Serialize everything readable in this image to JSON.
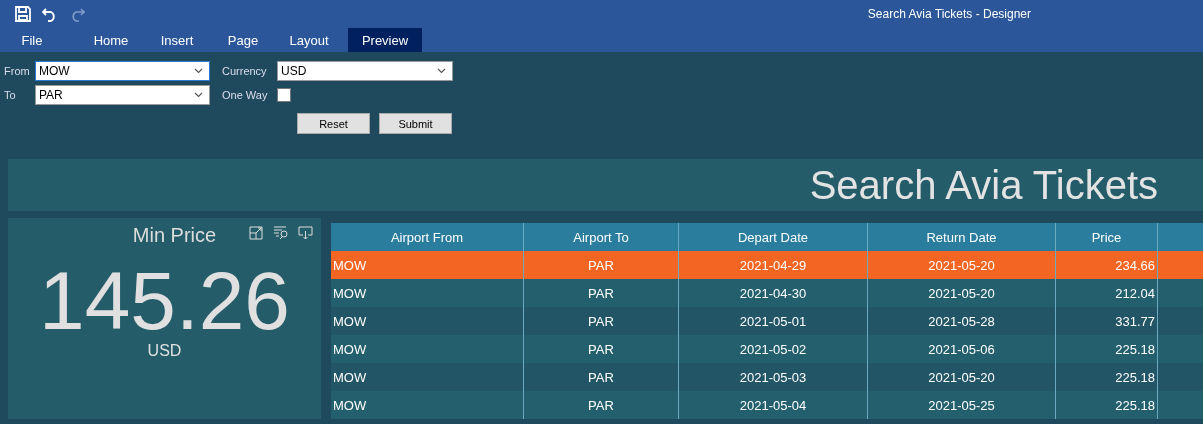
{
  "window": {
    "title": "Search Avia Tickets - Designer"
  },
  "tabs": [
    {
      "label": "File",
      "selected": false
    },
    {
      "label": "Home",
      "selected": false
    },
    {
      "label": "Insert",
      "selected": false
    },
    {
      "label": "Page",
      "selected": false
    },
    {
      "label": "Layout",
      "selected": false
    },
    {
      "label": "Preview",
      "selected": true
    }
  ],
  "form": {
    "from": {
      "label": "From",
      "value": "MOW"
    },
    "to": {
      "label": "To",
      "value": "PAR"
    },
    "currency": {
      "label": "Currency",
      "value": "USD"
    },
    "one_way": {
      "label": "One Way",
      "checked": false
    },
    "buttons": [
      "Reset",
      "Submit"
    ]
  },
  "banner": {
    "title": "Search Avia Tickets"
  },
  "min_price": {
    "title": "Min Price",
    "value": "145.26",
    "unit": "USD"
  },
  "table": {
    "columns": [
      "Airport From",
      "Airport To",
      "Depart Date",
      "Return Date",
      "Price"
    ],
    "rows": [
      {
        "cells": [
          "MOW",
          "PAR",
          "2021-04-29",
          "2021-05-20",
          "234.66"
        ],
        "selected": true
      },
      {
        "cells": [
          "MOW",
          "PAR",
          "2021-04-30",
          "2021-05-20",
          "212.04"
        ],
        "selected": false
      },
      {
        "cells": [
          "MOW",
          "PAR",
          "2021-05-01",
          "2021-05-28",
          "331.77"
        ],
        "selected": false
      },
      {
        "cells": [
          "MOW",
          "PAR",
          "2021-05-02",
          "2021-05-06",
          "225.18"
        ],
        "selected": false
      },
      {
        "cells": [
          "MOW",
          "PAR",
          "2021-05-03",
          "2021-05-20",
          "225.18"
        ],
        "selected": false
      },
      {
        "cells": [
          "MOW",
          "PAR",
          "2021-05-04",
          "2021-05-25",
          "225.18"
        ],
        "selected": false
      }
    ]
  }
}
